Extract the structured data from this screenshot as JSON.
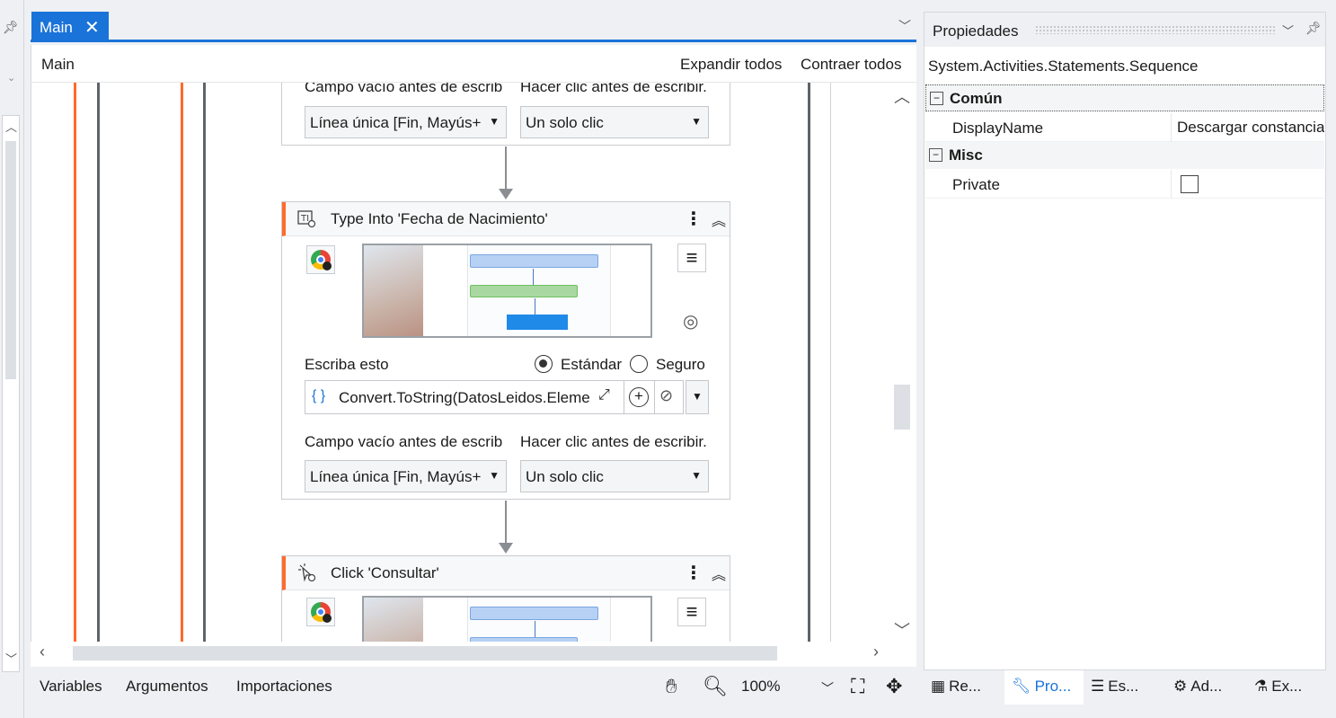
{
  "tab": {
    "title": "Main",
    "close_icon": "close-icon"
  },
  "designer": {
    "breadcrumb": "Main",
    "expand_all": "Expandir todos",
    "collapse_all": "Contraer todos"
  },
  "top_card": {
    "empty_field_label": "Campo vacío antes de escrib",
    "click_before_label": "Hacer clic antes de escribir.",
    "empty_field_value": "Línea única [Fin, Mayús+",
    "click_before_value": "Un solo clic"
  },
  "type_into": {
    "title": "Type Into 'Fecha de Nacimiento'",
    "type_this_label": "Escriba esto",
    "radio_standard": "Estándar",
    "radio_secure": "Seguro",
    "expression_value": "Convert.ToString(DatosLeidos.Eleme",
    "empty_field_label": "Campo vacío antes de escrib",
    "click_before_label": "Hacer clic antes de escribir.",
    "empty_field_value": "Línea única [Fin, Mayús+",
    "click_before_value": "Un solo clic"
  },
  "click": {
    "title": "Click 'Consultar'"
  },
  "bottom_bar": {
    "variables": "Variables",
    "arguments": "Argumentos",
    "imports": "Importaciones",
    "zoom": "100%"
  },
  "properties": {
    "title": "Propiedades",
    "type": "System.Activities.Statements.Sequence",
    "categories": [
      {
        "name": "Común",
        "rows": [
          {
            "name": "DisplayName",
            "value": "Descargar constancia"
          }
        ]
      },
      {
        "name": "Misc",
        "rows": [
          {
            "name": "Private",
            "value": ""
          }
        ]
      }
    ]
  },
  "panel_tabs": [
    "Re...",
    "Pro...",
    "Es...",
    "Ad...",
    "Ex..."
  ],
  "colors": {
    "accent": "#1a73d9",
    "activity_stripe": "#ff6a2b"
  }
}
